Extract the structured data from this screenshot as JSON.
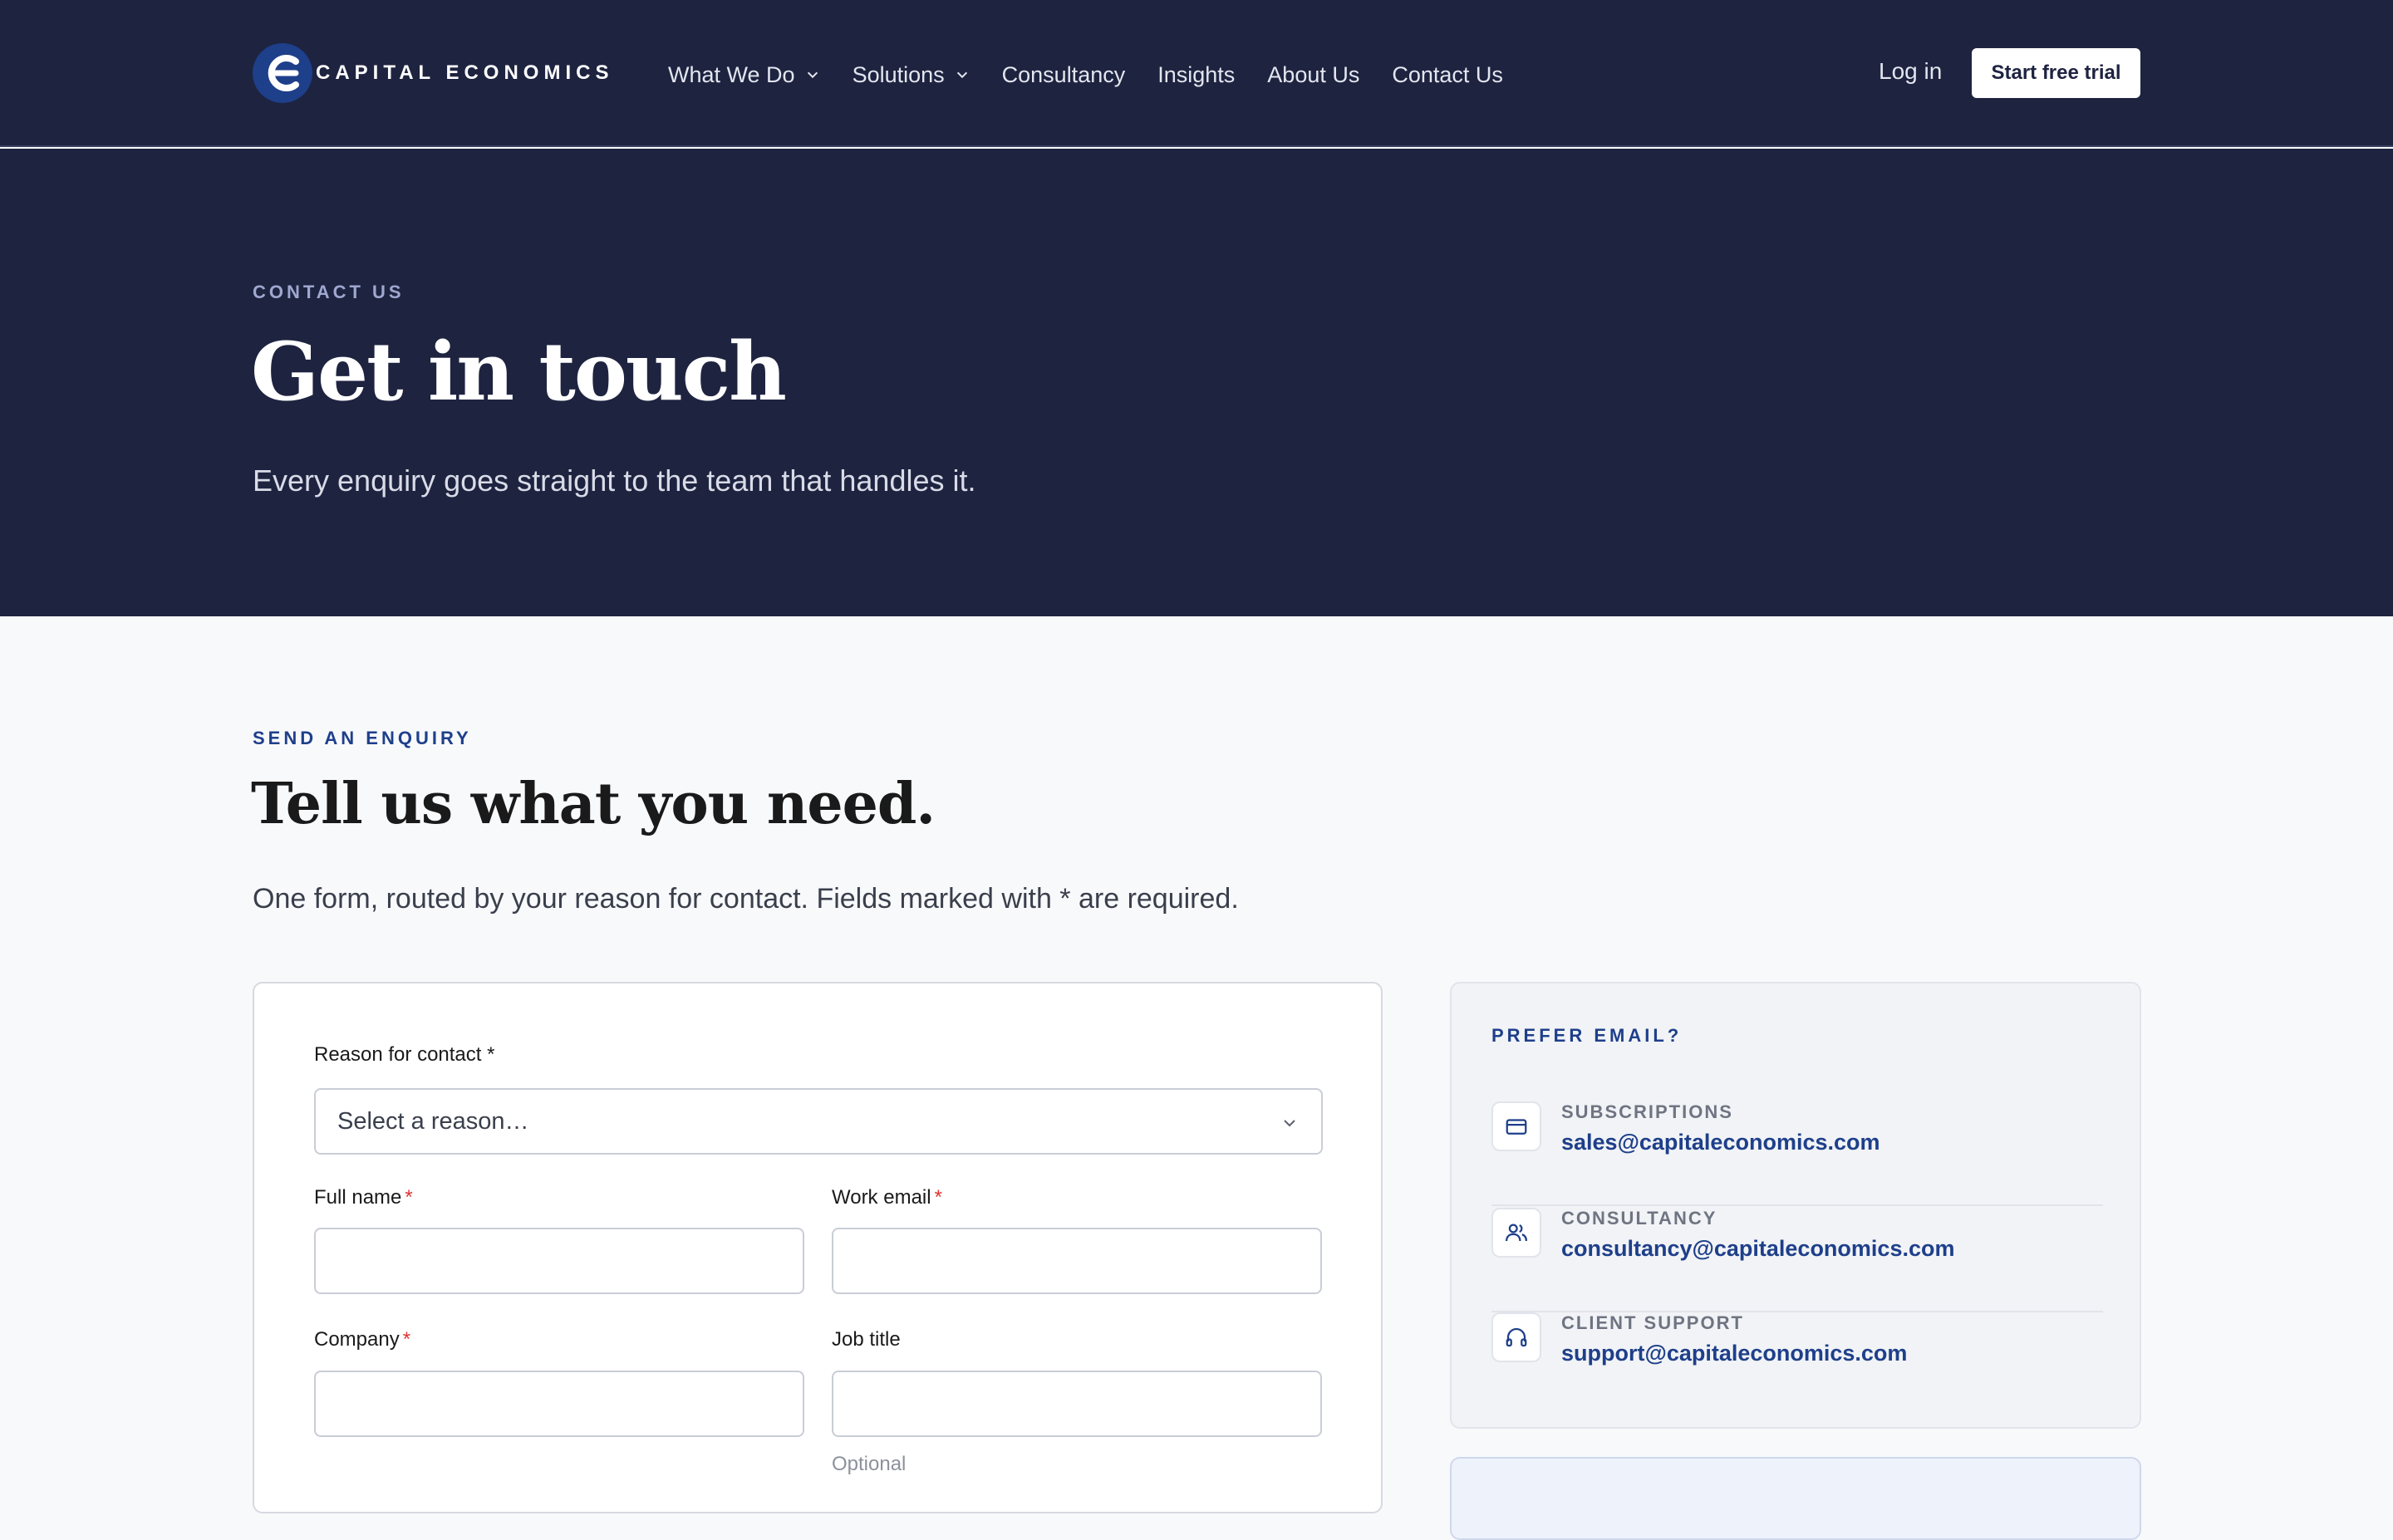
{
  "brand": {
    "name": "CAPITAL ECONOMICS",
    "color": "#1e3f8a"
  },
  "nav": {
    "links": [
      {
        "label": "What We Do",
        "dropdown": true
      },
      {
        "label": "Solutions",
        "dropdown": true
      },
      {
        "label": "Consultancy"
      },
      {
        "label": "Insights"
      },
      {
        "label": "About Us"
      },
      {
        "label": "Contact Us"
      }
    ],
    "login": "Log in",
    "cta": "Start free trial"
  },
  "hero": {
    "eyebrow": "CONTACT US",
    "title": "Get in touch",
    "subtitle": "Every enquiry goes straight to the team that handles it."
  },
  "section": {
    "eyebrow": "SEND AN ENQUIRY",
    "title": "Tell us what you need.",
    "subtitle": "One form, routed by your reason for contact. Fields marked with * are required."
  },
  "form": {
    "reason_label": "Reason for contact *",
    "reason_value": "Select a reason…",
    "full_name_label": "Full name",
    "work_email_label": "Work email",
    "company_label": "Company",
    "job_title_label": "Job title",
    "job_title_hint": "Optional",
    "required_mark": "*"
  },
  "email_panel": {
    "eyebrow": "PREFER EMAIL?",
    "contacts": [
      {
        "label": "SUBSCRIPTIONS",
        "email": "sales@capitaleconomics.com",
        "icon": "credit-card-icon"
      },
      {
        "label": "CONSULTANCY",
        "email": "consultancy@capitaleconomics.com",
        "icon": "users-icon"
      },
      {
        "label": "CLIENT SUPPORT",
        "email": "support@capitaleconomics.com",
        "icon": "headphones-icon"
      }
    ]
  },
  "colors": {
    "navy": "#1e2340",
    "accent": "#1e3f8a",
    "required": "#dd3333"
  }
}
